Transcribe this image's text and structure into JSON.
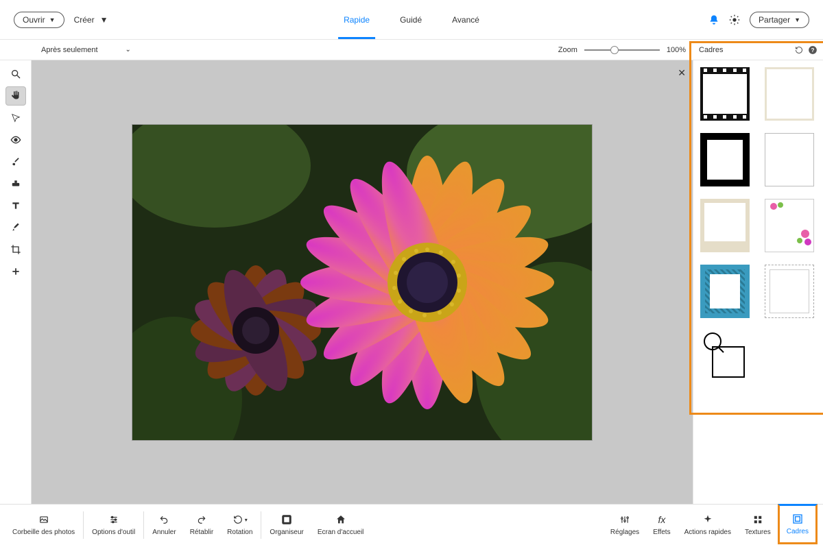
{
  "topbar": {
    "open_label": "Ouvrir",
    "create_label": "Créer",
    "share_label": "Partager"
  },
  "tabs": {
    "rapid": "Rapide",
    "guide": "Guidé",
    "advanced": "Avancé"
  },
  "options": {
    "view_mode": "Après seulement",
    "zoom_label": "Zoom",
    "zoom_value": "100%"
  },
  "panel": {
    "title": "Cadres",
    "frames": [
      {
        "id": "frame-film"
      },
      {
        "id": "frame-light-border"
      },
      {
        "id": "frame-thick-black"
      },
      {
        "id": "frame-thin"
      },
      {
        "id": "frame-polaroid"
      },
      {
        "id": "frame-flowers"
      },
      {
        "id": "frame-blue-weave"
      },
      {
        "id": "frame-stamp"
      },
      {
        "id": "frame-magnifier"
      }
    ]
  },
  "bottom": {
    "photo_bin": "Corbeille des photos",
    "tool_options": "Options d'outil",
    "undo": "Annuler",
    "redo": "Rétablir",
    "rotation": "Rotation",
    "organizer": "Organiseur",
    "home": "Ecran d'accueil",
    "adjustments": "Réglages",
    "effects": "Effets",
    "quick_actions": "Actions rapides",
    "textures": "Textures",
    "frames": "Cadres"
  }
}
